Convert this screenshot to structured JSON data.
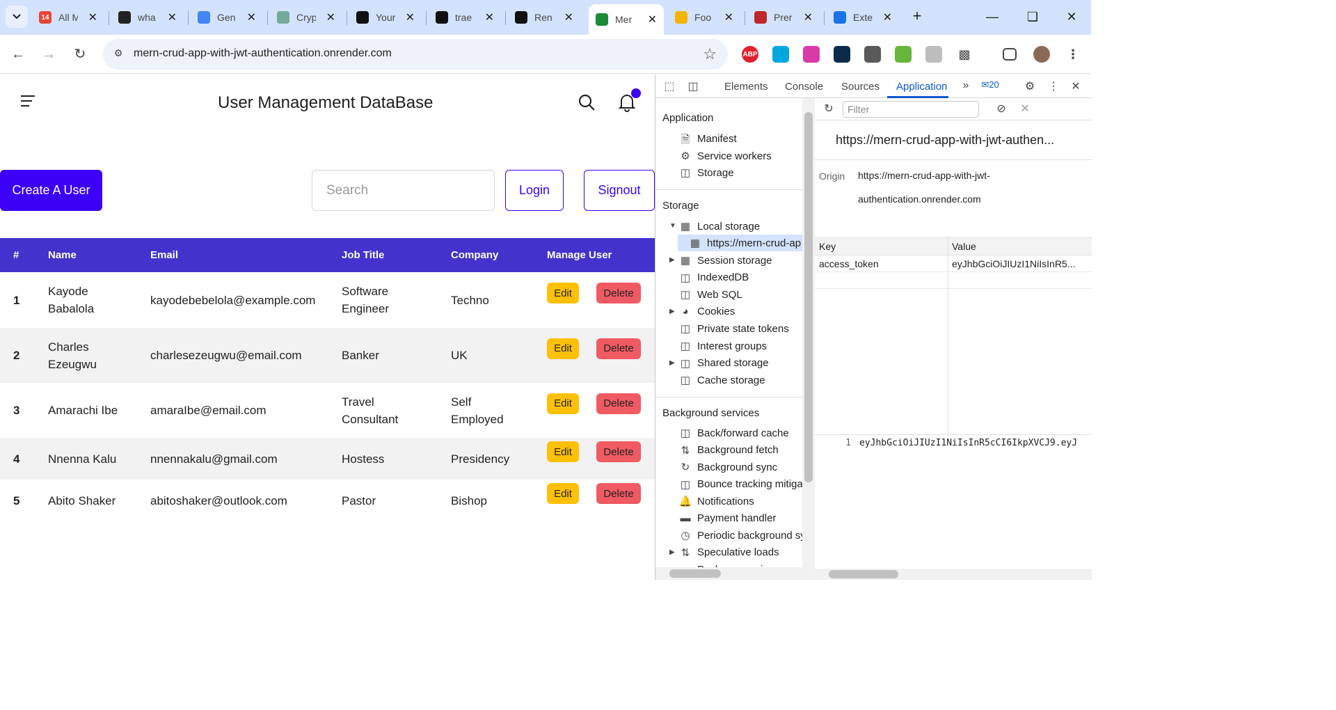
{
  "browser": {
    "tabs": [
      {
        "label": "All M",
        "favicon": "gmail-icon",
        "color": "#ea4335",
        "badge": "14"
      },
      {
        "label": "wha",
        "favicon": "app-icon",
        "color": "#222222"
      },
      {
        "label": "Gen",
        "favicon": "gemini-icon",
        "color": "#4285f4"
      },
      {
        "label": "Cryp",
        "favicon": "chatgpt-icon",
        "color": "#74aa9c"
      },
      {
        "label": "Your",
        "favicon": "github-icon",
        "color": "#111111"
      },
      {
        "label": "trae",
        "favicon": "github-icon",
        "color": "#111111"
      },
      {
        "label": "Ren",
        "favicon": "render-icon",
        "color": "#111111"
      },
      {
        "label": "Mer",
        "favicon": "map-icon",
        "color": "#1b8a3a",
        "active": true
      },
      {
        "label": "Foo",
        "favicon": "slides-icon",
        "color": "#f4b400"
      },
      {
        "label": "Prer",
        "favicon": "premiere-icon",
        "color": "#c0262b"
      },
      {
        "label": "Exte",
        "favicon": "puzzle-icon",
        "color": "#1a73e8"
      }
    ],
    "url": "mern-crud-app-with-jwt-authentication.onrender.com",
    "extensions": [
      {
        "name": "adblock-icon",
        "label": "ABP",
        "color": "#e0202f"
      },
      {
        "name": "translate-icon",
        "label": "",
        "color": "#00a7e1"
      },
      {
        "name": "color-picker-icon",
        "label": "",
        "color": "#d93ba6"
      },
      {
        "name": "react-icon",
        "label": "",
        "color": "#0b2b4a"
      },
      {
        "name": "pen-icon",
        "label": "",
        "color": "#5a5a5a"
      },
      {
        "name": "block-icon",
        "label": "",
        "color": "#68b53b"
      },
      {
        "name": "record-icon",
        "label": "",
        "color": "#bdbdbd"
      }
    ]
  },
  "app": {
    "title": "User Management DataBase",
    "create_button": "Create A User",
    "search_placeholder": "Search",
    "login_button": "Login",
    "signout_button": "Signout",
    "columns": [
      "#",
      "Name",
      "Email",
      "Job Title",
      "Company",
      "Manage User"
    ],
    "rows": [
      {
        "num": "1",
        "name": [
          "Kayode",
          "Babalola"
        ],
        "email": "kayodebebelola@example.com",
        "job": [
          "Software",
          "Engineer"
        ],
        "company": [
          "Techno"
        ]
      },
      {
        "num": "2",
        "name": [
          "Charles",
          "Ezeugwu"
        ],
        "email": "charlesezeugwu@email.com",
        "job": [
          "Banker"
        ],
        "company": [
          "UK"
        ]
      },
      {
        "num": "3",
        "name": [
          "Amarachi Ibe"
        ],
        "email": "amaraIbe@email.com",
        "job": [
          "Travel",
          "Consultant"
        ],
        "company": [
          "Self",
          "Employed"
        ]
      },
      {
        "num": "4",
        "name": [
          "Nnenna Kalu"
        ],
        "email": "nnennakalu@gmail.com",
        "job": [
          "Hostess"
        ],
        "company": [
          "Presidency"
        ]
      },
      {
        "num": "5",
        "name": [
          "Abito Shaker"
        ],
        "email": "abitoshaker@outlook.com",
        "job": [
          "Pastor"
        ],
        "company": [
          "Bishop"
        ]
      }
    ],
    "edit_label": "Edit",
    "delete_label": "Delete",
    "accent_color": "#3b00f5",
    "header_color": "#4333cc"
  },
  "devtools": {
    "tabs": [
      "Elements",
      "Console",
      "Sources",
      "Application"
    ],
    "active_tab": "Application",
    "issues_count": "20",
    "sidebar": {
      "application_heading": "Application",
      "application_items": [
        "Manifest",
        "Service workers",
        "Storage"
      ],
      "storage_heading": "Storage",
      "local_storage": "Local storage",
      "local_storage_origin": "https://mern-crud-ap",
      "storage_items": [
        "Session storage",
        "IndexedDB",
        "Web SQL",
        "Cookies",
        "Private state tokens",
        "Interest groups",
        "Shared storage",
        "Cache storage"
      ],
      "background_heading": "Background services",
      "background_items": [
        "Back/forward cache",
        "Background fetch",
        "Background sync",
        "Bounce tracking mitiga",
        "Notifications",
        "Payment handler",
        "Periodic background sy",
        "Speculative loads",
        "Push messaging"
      ]
    },
    "filter_placeholder": "Filter",
    "origin_title": "https://mern-crud-app-with-jwt-authen...",
    "origin_label": "Origin",
    "origin_value": [
      "https://mern-crud-app-with-jwt-",
      "authentication.onrender.com"
    ],
    "kv_headers": [
      "Key",
      "Value"
    ],
    "kv_rows": [
      {
        "key": "access_token",
        "value": "eyJhbGciOiJIUzI1NiIsInR5..."
      }
    ],
    "preview_line": "1",
    "preview_value": "eyJhbGciOiJIUzI1NiIsInR5cCI6IkpXVCJ9.eyJ"
  }
}
